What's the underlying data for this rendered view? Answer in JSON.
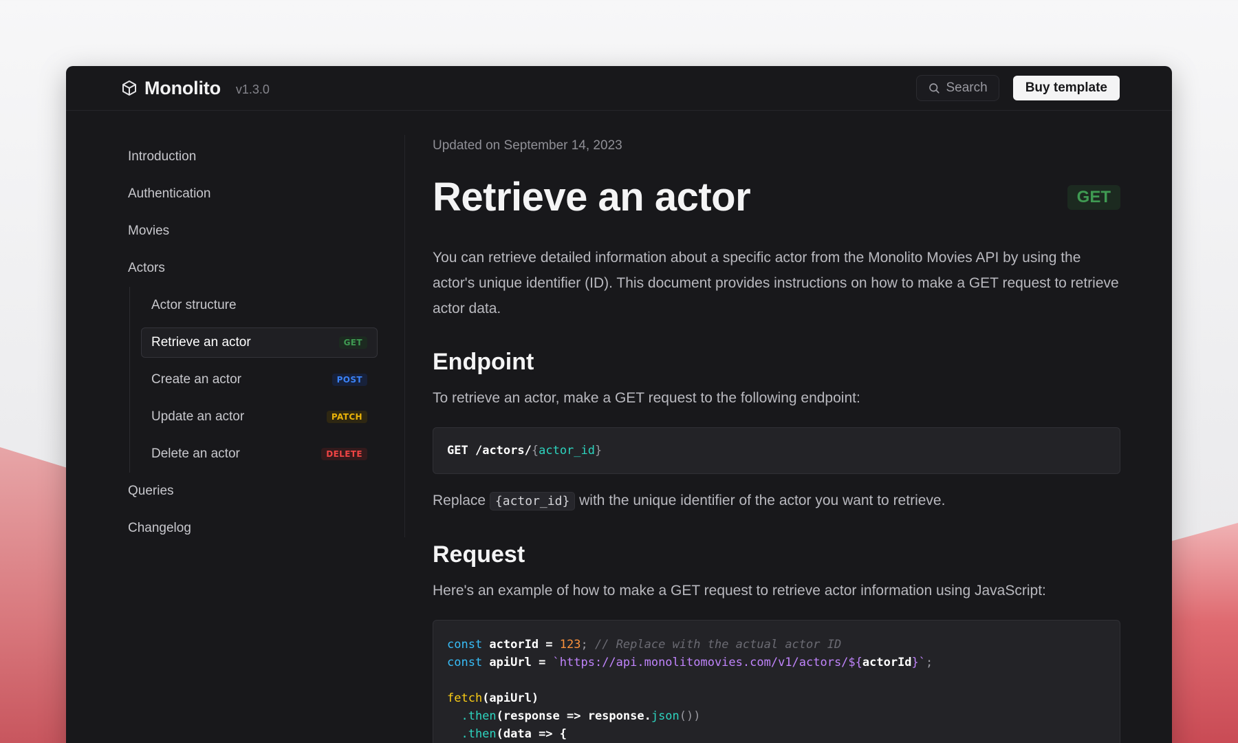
{
  "app": {
    "name": "Monolito",
    "version": "v1.3.0"
  },
  "topbar": {
    "search_label": "Search",
    "buy_label": "Buy template"
  },
  "sidebar": {
    "items": [
      {
        "label": "Introduction"
      },
      {
        "label": "Authentication"
      },
      {
        "label": "Movies"
      },
      {
        "label": "Actors"
      }
    ],
    "actors_sub": [
      {
        "label": "Actor structure",
        "badge": ""
      },
      {
        "label": "Retrieve an actor",
        "badge": "GET",
        "active": true
      },
      {
        "label": "Create an actor",
        "badge": "POST"
      },
      {
        "label": "Update an actor",
        "badge": "PATCH"
      },
      {
        "label": "Delete an actor",
        "badge": "DELETE"
      }
    ],
    "after": [
      {
        "label": "Queries"
      },
      {
        "label": "Changelog"
      }
    ]
  },
  "main": {
    "updated": "Updated on September 14, 2023",
    "title": "Retrieve an actor",
    "method": "GET",
    "intro": "You can retrieve detailed information about a specific actor from the Monolito Movies API by using the actor's unique identifier (ID). This document provides instructions on how to make a GET request to retrieve actor data.",
    "endpoint_heading": "Endpoint",
    "endpoint_text": "To retrieve an actor, make a GET request to the following endpoint:",
    "endpoint_code": {
      "method": "GET",
      "path": "/actors/",
      "open": "{",
      "param": "actor_id",
      "close": "}"
    },
    "replace_before": "Replace",
    "replace_code": "{actor_id}",
    "replace_after": "with the unique identifier of the actor you want to retrieve.",
    "request_heading": "Request",
    "request_text": "Here's an example of how to make a GET request to retrieve actor information using JavaScript:",
    "code_lines": {
      "l1_kw": "const",
      "l1_var": " actorId = ",
      "l1_num": "123",
      "l1_semi": ";",
      "l1_comment": " // Replace with the actual actor ID",
      "l2_kw": "const",
      "l2_var": " apiUrl = ",
      "l2_str": "`https://api.monolitomovies.com/v1/actors/${",
      "l2_interp": "actorId",
      "l2_end": "}`",
      "l2_semi": ";",
      "l4_fn": "fetch",
      "l4_rest": "(apiUrl)",
      "l5_then": "  .then",
      "l5_rest": "(response => response.",
      "l5_json": "json",
      "l5_end": "())",
      "l6_then": "  .then",
      "l6_rest": "(data => {"
    }
  },
  "colors": {
    "background": "#18181b",
    "get": "#3f9a52",
    "post": "#3b82f6",
    "patch": "#eab308",
    "delete": "#ef4444"
  }
}
